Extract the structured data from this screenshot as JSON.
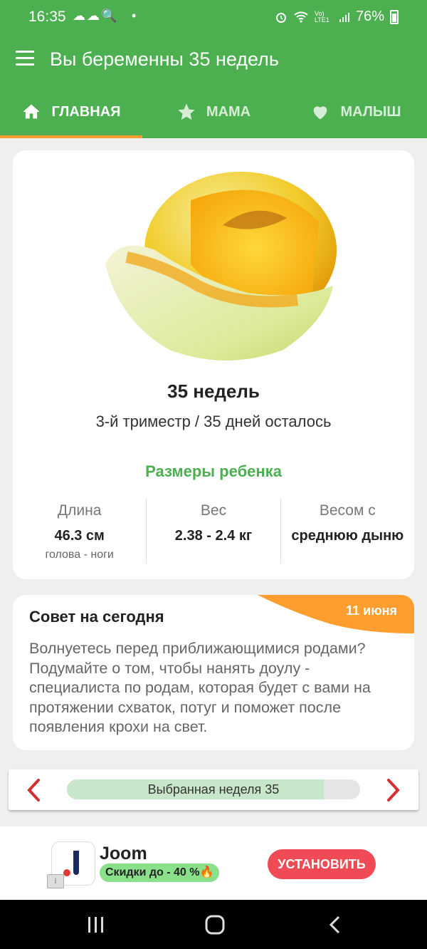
{
  "status_bar": {
    "time": "16:35",
    "left_icons": "☁☁🔍",
    "dot": "•",
    "signal_text": "Vo) LTE1",
    "battery": "76%"
  },
  "app_bar": {
    "title": "Вы беременны 35 недель"
  },
  "tabs": [
    {
      "label": "ГЛАВНАЯ",
      "icon": "home-icon",
      "active": true
    },
    {
      "label": "МАМА",
      "icon": "star-icon",
      "active": false
    },
    {
      "label": "МАЛЫШ",
      "icon": "heart-icon",
      "active": false
    }
  ],
  "week_card": {
    "fruit_image": "melon",
    "weeks": "35 недель",
    "trimester": "3-й триместр / 35 дней осталось",
    "sizes_title": "Размеры ребенка",
    "stats": [
      {
        "label": "Длина",
        "value": "46.3 см",
        "sub": "голова - ноги"
      },
      {
        "label": "Вес",
        "value": "2.38 - 2.4 кг",
        "sub": ""
      },
      {
        "label": "Весом с",
        "value": "среднюю дыню",
        "sub": ""
      }
    ]
  },
  "tip_card": {
    "title": "Совет на сегодня",
    "date": "11 июня",
    "body": "Волнуетесь перед приближающимися родами? Подумайте о том, чтобы нанять доулу - специалиста по родам, которая будет с вами на протяжении схваток, потуг и поможет после появления крохи на свет."
  },
  "week_selector": {
    "label": "Выбранная неделя 35",
    "progress": 0.875
  },
  "ad": {
    "name": "Joom",
    "promo": "Скидки до - 40 %🔥",
    "info_icon": "i",
    "button": "УСТАНОВИТЬ"
  },
  "colors": {
    "primary": "#4caf50",
    "accent": "#ff9d2e",
    "ad_button": "#ef4a56"
  }
}
